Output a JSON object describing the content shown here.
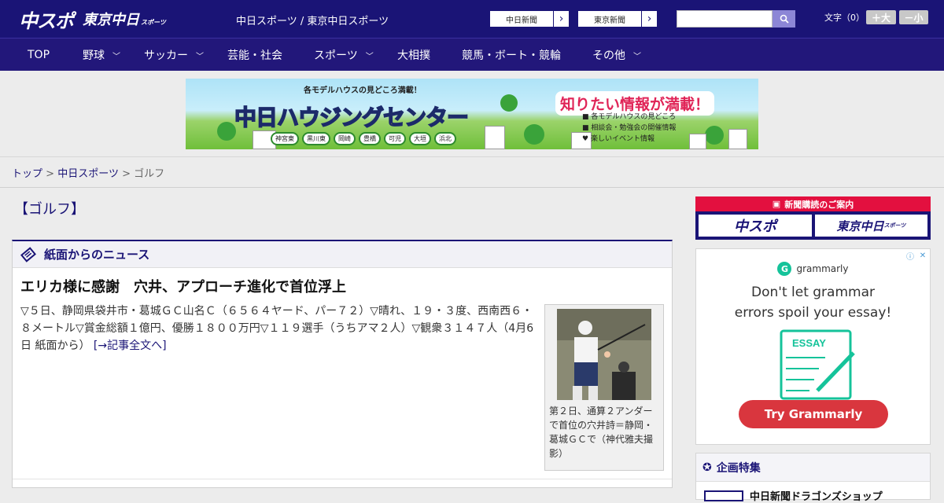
{
  "header": {
    "logo_main": "中スポ",
    "logo_sub": "東京中日",
    "logo_sub_small": "スポーツ",
    "site_titles": "中日スポーツ / 東京中日スポーツ",
    "paper_links": [
      "中日新聞",
      "東京新聞"
    ],
    "search_placeholder": "",
    "font_size_label": "文字（0）",
    "font_larger": "＋大",
    "font_smaller": "－小"
  },
  "nav": {
    "items": [
      {
        "label": "TOP"
      },
      {
        "label": "野球"
      },
      {
        "label": "サッカー"
      },
      {
        "label": "芸能・社会"
      },
      {
        "label": "スポーツ"
      },
      {
        "label": "大相撲"
      },
      {
        "label": "競馬・ボート・競輪"
      },
      {
        "label": "その他"
      }
    ]
  },
  "banner": {
    "top_text": "各モデルハウスの見どころ満載！",
    "title": "中日ハウジングセンター",
    "right_title": "知りたい情報が満載！",
    "bullets": [
      "各モデルハウスの見どころ",
      "相談会・勉強会の開催情報",
      "楽しいイベント情報"
    ],
    "towns": [
      "神宮東",
      "黒川東",
      "岡崎",
      "豊橋",
      "可児",
      "大垣",
      "浜北"
    ]
  },
  "breadcrumb": {
    "home": "トップ",
    "section": "中日スポーツ",
    "current": "ゴルフ",
    "separator": ">"
  },
  "page_heading": "【ゴルフ】",
  "news": {
    "box_title": "紙面からのニュース",
    "article_title": "エリカ様に感謝　穴井、アプローチ進化で首位浮上",
    "article_body": "▽５日、静岡県袋井市・葛城ＧＣ山名Ｃ（６５６４ヤード、パー７２）▽晴れ、１９・３度、西南西６・８メートル▽賞金総額１億円、優勝１８００万円▽１１９選手（うちアマ２人）▽観衆３１４７人（4月6日 紙面から）",
    "more_link": "[→記事全文へ]",
    "photo_caption": "第２日、通算２アンダーで首位の穴井詩＝静岡・葛城ＧＣで（神代雅夫撮影）"
  },
  "sidebar": {
    "subscribe_head": "新聞購読のご案内",
    "subscribe_buttons": [
      "中スポ",
      "東京中日"
    ],
    "subscribe_small": "スポーツ",
    "ad": {
      "brand": "grammarly",
      "text_line1": "Don't let grammar",
      "text_line2": "errors spoil your essay!",
      "essay_label": "ESSAY",
      "cta": "Try Grammarly"
    },
    "feature_head": "企画特集",
    "feature_item": "中日新聞ドラゴンズショップ"
  },
  "colors": {
    "brand_navy": "#1a1476",
    "accent_red": "#e3103f",
    "grammarly_green": "#15c39a",
    "grammarly_red": "#d9363e"
  }
}
